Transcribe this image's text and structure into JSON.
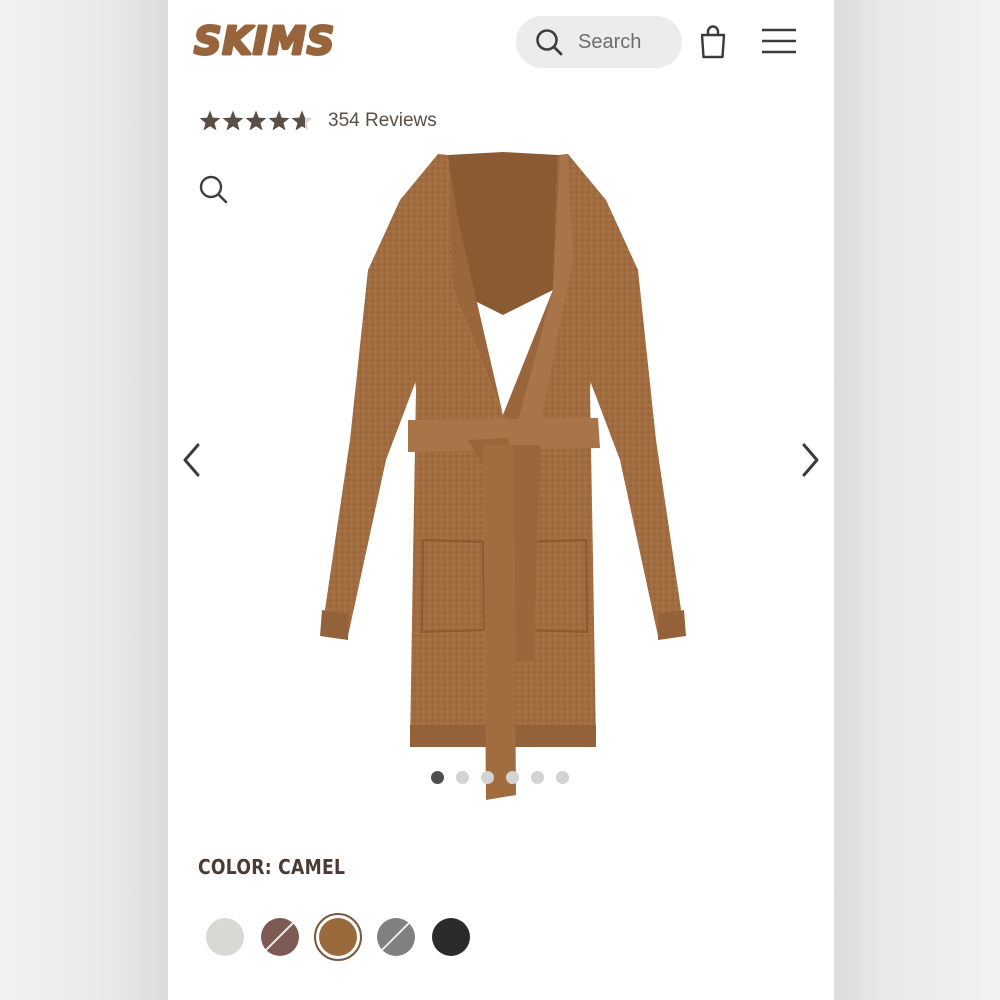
{
  "header": {
    "logo_text": "SKIMS",
    "search_label": "Search",
    "icons": [
      "search-icon",
      "shopping-bag-icon",
      "hamburger-menu-icon"
    ]
  },
  "product": {
    "rating": 4.5,
    "reviews_label": "354 Reviews",
    "image_description_icon": "zoom-icon",
    "carousel": {
      "total": 6,
      "active_index": 0
    },
    "color_label": "COLOR: CAMEL",
    "swatches": [
      {
        "name": "swatch-1",
        "color": "#d8d9d2",
        "slash": false,
        "selected": false
      },
      {
        "name": "swatch-2",
        "color": "#7e5a55",
        "slash": true,
        "selected": false
      },
      {
        "name": "swatch-camel",
        "color": "#9a6a3d",
        "slash": false,
        "selected": true
      },
      {
        "name": "swatch-4",
        "color": "#808080",
        "slash": true,
        "selected": false
      },
      {
        "name": "swatch-5",
        "color": "#2b2b2b",
        "slash": false,
        "selected": false
      }
    ]
  },
  "colors": {
    "brand": "#98643c",
    "text_dark": "#4a3c33",
    "star": "#5a4f47"
  }
}
